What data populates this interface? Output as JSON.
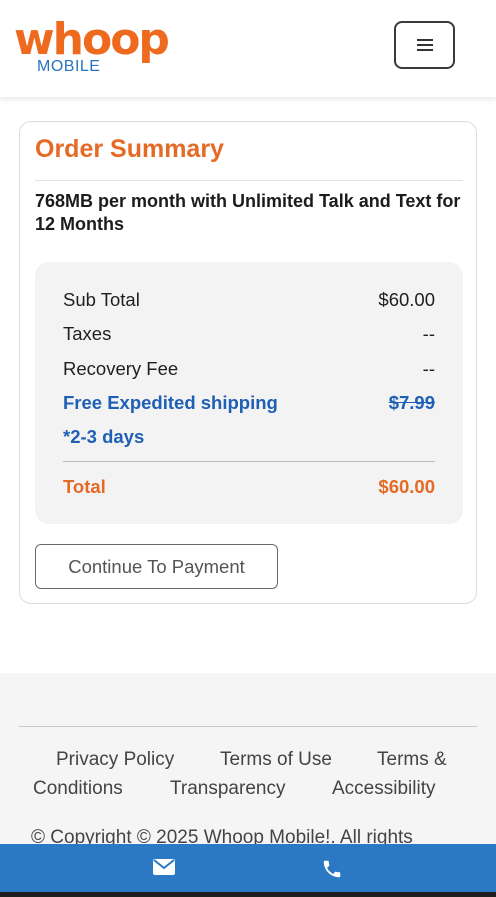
{
  "brand": {
    "logo_main": "whoop",
    "logo_sub": "MOBILE",
    "accent_color": "#e46a26",
    "blue_color": "#2b78c5"
  },
  "header": {
    "menu_icon": "hamburger-icon"
  },
  "order_summary": {
    "title": "Order Summary",
    "plan": "768MB per month with Unlimited Talk and Text for 12 Months",
    "rows": [
      {
        "label": "Sub Total",
        "value": "$60.00"
      },
      {
        "label": "Taxes",
        "value": "--"
      },
      {
        "label": "Recovery Fee",
        "value": "--"
      }
    ],
    "shipping": {
      "label_line1": "Free Expedited shipping",
      "label_line2": "*2-3 days",
      "value": "$7.99"
    },
    "total": {
      "label": "Total",
      "value": "$60.00"
    },
    "continue_label": "Continue To Payment"
  },
  "footer": {
    "links": [
      "Privacy Policy",
      "Terms of Use",
      "Terms &",
      "Conditions",
      "Transparency",
      "Accessibility"
    ],
    "copyright": "© Copyright © 2025 Whoop Mobile!. All rights"
  },
  "contact_bar": {
    "icons": [
      "envelope-icon",
      "phone-icon"
    ]
  }
}
